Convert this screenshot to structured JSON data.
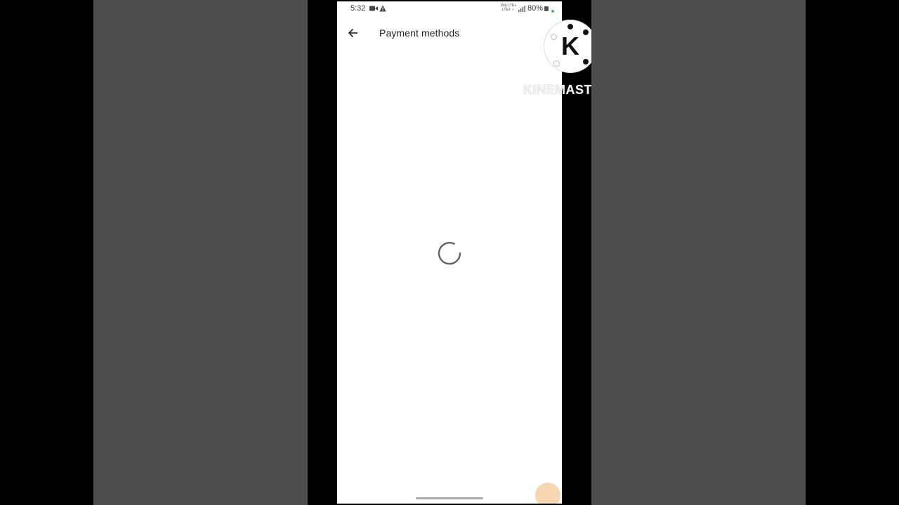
{
  "status_bar": {
    "time": "5:32",
    "network_line1": "Vo)) LTE+",
    "network_line2": "LTE2 ↓↑",
    "battery_percent": "80%",
    "icons": [
      "video-camera-icon",
      "alert-triangle-icon",
      "signal-bars-icon",
      "battery-icon"
    ]
  },
  "app_bar": {
    "back_icon": "arrow-back-icon",
    "title": "Payment methods"
  },
  "content": {
    "loading": true,
    "spinner_icon": "loading-spinner-icon"
  },
  "watermark": {
    "logo_letter": "K",
    "text": "KINEMAST"
  },
  "colors": {
    "background_outer": "#000000",
    "blur_panels": "#4e4e4e",
    "screen_background": "#ffffff",
    "title_text": "#202124",
    "spinner": "#5f6368",
    "status_dot": "#3dbd5d"
  }
}
